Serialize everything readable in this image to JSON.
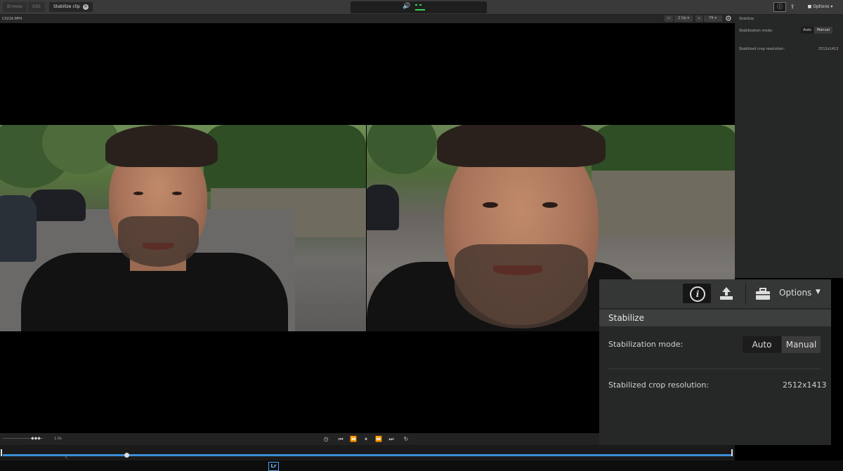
{
  "topbar": {
    "tabs": [
      "Browse",
      "Edit",
      "Stabilize clip"
    ],
    "options_label": "Options"
  },
  "viewer": {
    "filename": "C0216.MP4",
    "view_mode": "2 Up",
    "zoom": "Fit"
  },
  "small_panel": {
    "title": "Stabilize",
    "mode_label": "Stabilization mode:",
    "mode_auto": "Auto",
    "mode_manual": "Manual",
    "crop_label": "Stabilized crop resolution:",
    "crop_value": "2512x1413"
  },
  "overlay_panel": {
    "options_label": "Options",
    "title": "Stabilize",
    "mode_label": "Stabilization mode:",
    "mode_auto": "Auto",
    "mode_manual": "Manual",
    "crop_label": "Stabilized crop resolution:",
    "crop_value": "2512x1413"
  },
  "transport": {
    "speed": "1.0x"
  },
  "bottom": {
    "lr_badge": "Lr"
  },
  "playhead_fraction": 0.17,
  "colors": {
    "accent_blue": "#3a8fd8",
    "meter_green": "#3bd15a"
  },
  "icons": [
    "volume-icon",
    "info-icon",
    "export-icon",
    "briefcase-icon",
    "gear-icon",
    "search-icon",
    "compare-icon"
  ]
}
